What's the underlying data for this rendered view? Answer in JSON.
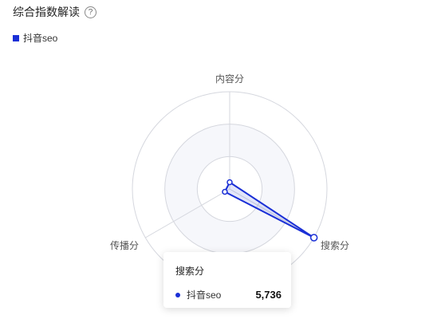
{
  "header": {
    "title": "综合指数解读",
    "help_icon": "?"
  },
  "legend": {
    "label": "抖音seo",
    "color": "#1a2fd6"
  },
  "chart_data": {
    "type": "radar",
    "indicators": [
      "内容分",
      "搜索分",
      "传播分"
    ],
    "max": 5736,
    "grid": true,
    "series": [
      {
        "name": "抖音seo",
        "values": [
          400,
          5736,
          200
        ],
        "color": "#1a2fd6"
      }
    ]
  },
  "tooltip": {
    "title": "搜索分",
    "series_name": "抖音seo",
    "value": "5,736"
  }
}
